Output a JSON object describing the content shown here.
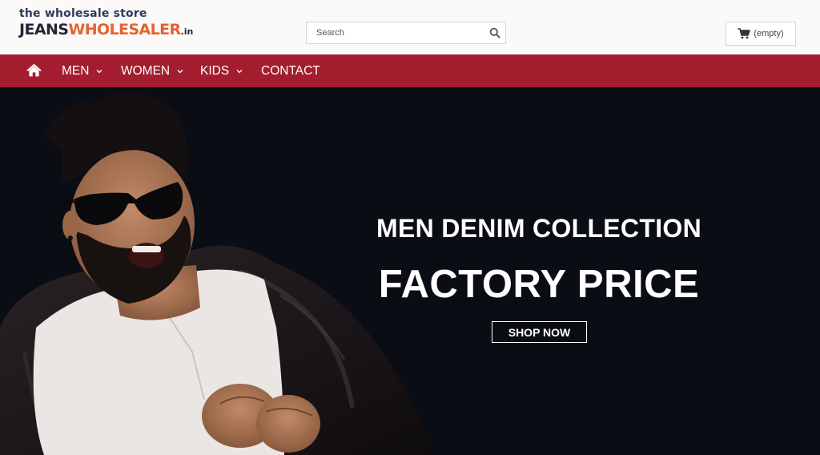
{
  "header": {
    "logo_tagline": "the wholesale store",
    "logo_part1": "JEANS",
    "logo_part2": "WHOLESALER",
    "logo_part3": ".in",
    "search": {
      "placeholder": "Search",
      "value": ""
    },
    "cart_label": "(empty)"
  },
  "nav": {
    "home_icon": "home-icon",
    "items": [
      {
        "label": "MEN",
        "has_dropdown": true
      },
      {
        "label": "WOMEN",
        "has_dropdown": true
      },
      {
        "label": "KIDS",
        "has_dropdown": true
      },
      {
        "label": "CONTACT",
        "has_dropdown": false
      }
    ]
  },
  "hero": {
    "subtitle": "MEN DENIM COLLECTION",
    "title": "FACTORY PRICE",
    "cta": "SHOP NOW"
  },
  "colors": {
    "nav_bg": "#a31d2f",
    "hero_bg": "#0b0d14",
    "logo_accent": "#e5622e",
    "logo_dark": "#222733",
    "tagline": "#2e3a5c"
  }
}
